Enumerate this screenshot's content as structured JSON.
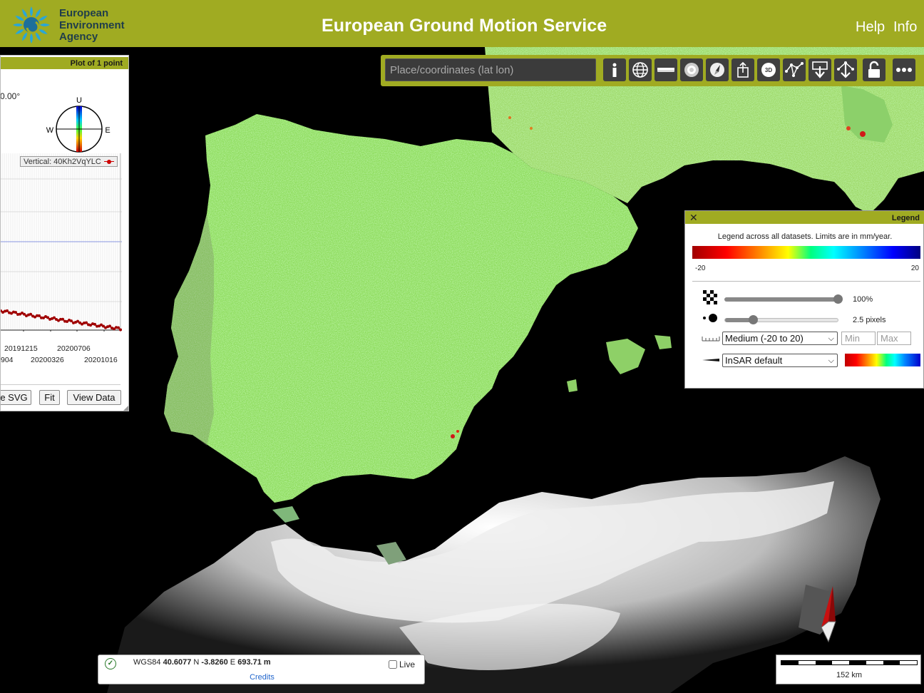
{
  "header": {
    "logo_lines": [
      "European",
      "Environment",
      "Agency"
    ],
    "title": "European Ground Motion Service",
    "links": [
      "Help",
      "Info"
    ]
  },
  "toolbar": {
    "search_placeholder": "Place/coordinates (lat lon)",
    "buttons": [
      "info-icon",
      "globe-icon",
      "ruler-icon",
      "settings-icon",
      "compass-icon",
      "share-icon",
      "3d-icon",
      "measure-icon",
      "download-icon",
      "network-icon",
      "lock-icon",
      "more-icon"
    ],
    "label_3d": "3D"
  },
  "plot_panel": {
    "title": "Plot of 1 point",
    "angle": "0.00°",
    "compass": {
      "up": "U",
      "west": "W",
      "east": "E"
    },
    "series_legend": "Vertical: 40Kh2VqYLC",
    "x_ticks_top": [
      "20191215",
      "20200706"
    ],
    "x_ticks_bottom": [
      "904",
      "20200326",
      "20201016"
    ],
    "buttons": [
      "e SVG",
      "Fit",
      "View Data"
    ]
  },
  "legend_panel": {
    "title": "Legend",
    "close": "✕",
    "note": "Legend across all datasets. Limits are in mm/year.",
    "min": "-20",
    "max": "20",
    "opacity": {
      "value": 1.0,
      "label": "100%"
    },
    "point_size": {
      "value": 2.5,
      "min": 0,
      "max": 10,
      "label": "2.5 pixels"
    },
    "range_select": "Medium (-20 to 20)",
    "min_placeholder": "Min",
    "max_placeholder": "Max",
    "colormap_select": "InSAR default"
  },
  "coords_box": {
    "prefix": "WGS84",
    "lat": "40.6077",
    "lat_dir": "N",
    "lon": "-3.8260",
    "lon_dir": "E",
    "elevation": "693.71 m",
    "credits": "Credits",
    "live_label": "Live"
  },
  "scale": {
    "label": "152 km"
  },
  "colors": {
    "accent": "#a0ab22",
    "map_background": "#000000"
  }
}
